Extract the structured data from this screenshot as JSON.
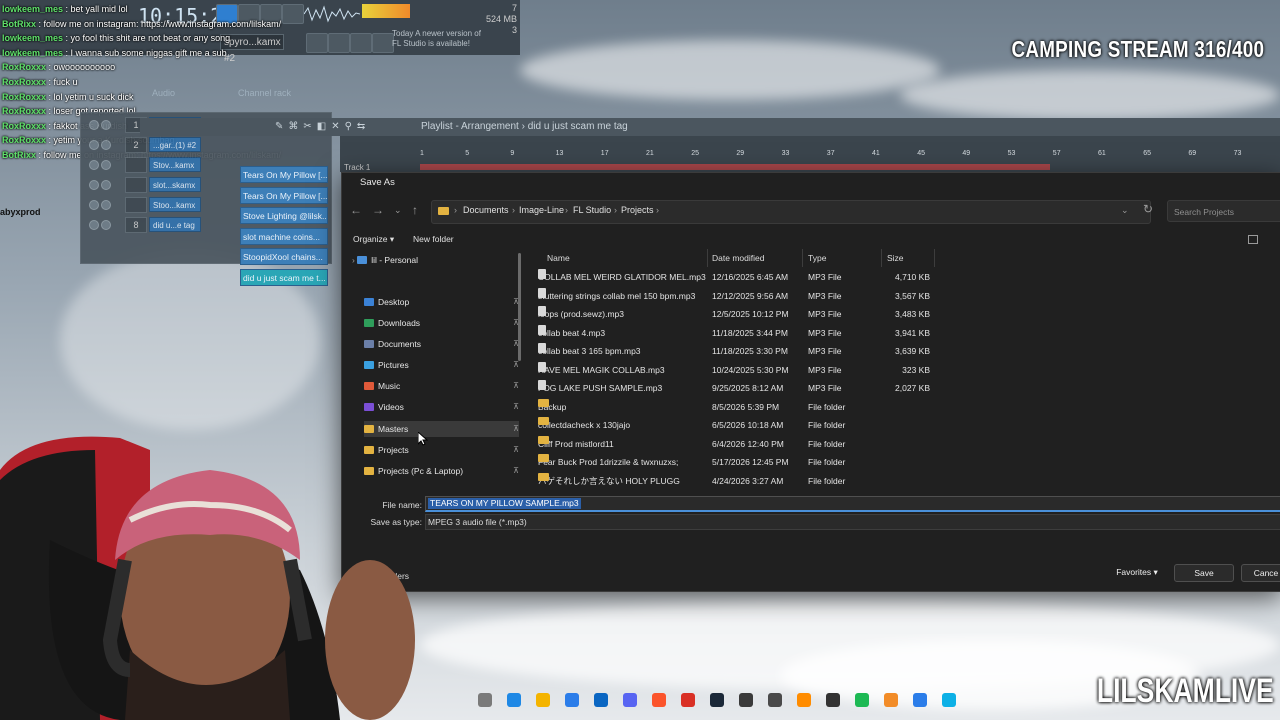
{
  "fl_studio": {
    "clock": "10:15:22",
    "stats": [
      "7",
      "524 MB",
      "3"
    ],
    "pattern_name": "spyro...kamx #2",
    "update_notice": "Today  A newer version of FL Studio is available!",
    "channel_rack_title": "Channel rack",
    "audio_label": "Audio",
    "channels": [
      {
        "num": "1",
        "label": "Tear..ls] (1)"
      },
      {
        "num": "2",
        "label": "...gar..(1) #2"
      },
      {
        "num": "",
        "label": "Stov...kamx"
      },
      {
        "num": "",
        "label": "slot...skamx"
      },
      {
        "num": "",
        "label": "Stoo...kamx"
      },
      {
        "num": "8",
        "label": "did u...e tag"
      }
    ],
    "playlist_title": "Playlist - Arrangement › did u just scam me tag",
    "track_label": "Track 1",
    "playlist_clips": [
      "Tears On My Pillow [...",
      "Tears On My Pillow [...",
      "Stove Lighting @lilsk...",
      "slot machine coins...",
      "StoopidXool chains...",
      "did u just scam me t..."
    ],
    "ruler_marks": [
      "1",
      "5",
      "9",
      "13",
      "17",
      "21",
      "25",
      "29",
      "33",
      "37",
      "41",
      "45",
      "49",
      "53",
      "57",
      "61",
      "65",
      "69",
      "73"
    ]
  },
  "chat": [
    {
      "user": "lowkeem_mes",
      "text": " : bet yall mid lol"
    },
    {
      "user": "BotRixx",
      "text": " : follow me on instagram: https://www.instagram.com/lilskam/"
    },
    {
      "user": "lowkeem_mes",
      "text": " : yo fool this shit are not beat or any song"
    },
    {
      "user": "lowkeem_mes",
      "text": " : I wanna sub some niggas gift me a sub"
    },
    {
      "user": "RoxRoxxx",
      "text": " : owoooooooooo"
    },
    {
      "user": "RoxRoxxx",
      "text": " : fuck u"
    },
    {
      "user": "RoxRoxxx",
      "text": " : lol yetim u suck dick"
    },
    {
      "user": "RoxRoxxx",
      "text": " : loser got reported lol"
    },
    {
      "user": "RoxRoxxx",
      "text": " : fakkot ass Kurdish"
    },
    {
      "user": "RoxRoxxx",
      "text": " : yetim your a Kurdish scumbag"
    },
    {
      "user": "BotRixx",
      "text": " : follow me on instagram: https://www.instagram.com/lilskam/"
    }
  ],
  "dialog": {
    "title": "Save As",
    "breadcrumbs": [
      "Documents",
      "Image-Line",
      "FL Studio",
      "Projects"
    ],
    "search_placeholder": "Search Projects",
    "organize_label": "Organize ▾",
    "new_folder_label": "New folder",
    "nav_items": [
      {
        "label": "lil - Personal",
        "color": "#4a90d9"
      },
      {
        "label": "Desktop",
        "color": "#3b82d6"
      },
      {
        "label": "Downloads",
        "color": "#2f9e5b"
      },
      {
        "label": "Documents",
        "color": "#6b7fa8"
      },
      {
        "label": "Pictures",
        "color": "#3aa0e0"
      },
      {
        "label": "Music",
        "color": "#e05a3a"
      },
      {
        "label": "Videos",
        "color": "#7b4fd6"
      },
      {
        "label": "Masters",
        "color": "#e3b341"
      },
      {
        "label": "Projects",
        "color": "#e3b341"
      },
      {
        "label": "Projects (Pc & Laptop)",
        "color": "#e3b341"
      }
    ],
    "columns": {
      "name": "Name",
      "date": "Date modified",
      "type": "Type",
      "size": "Size"
    },
    "files": [
      {
        "name": "COLLAB MEL WEIRD GLATIDOR MEL.mp3",
        "date": "12/16/2025 6:45 AM",
        "type": "MP3 File",
        "size": "4,710 KB",
        "kind": "mp3"
      },
      {
        "name": "stuttering strings collab mel 150 bpm.mp3",
        "date": "12/12/2025 9:56 AM",
        "type": "MP3 File",
        "size": "3,567 KB",
        "kind": "mp3"
      },
      {
        "name": "loops (prod.sewz).mp3",
        "date": "12/5/2025 10:12 PM",
        "type": "MP3 File",
        "size": "3,483 KB",
        "kind": "mp3"
      },
      {
        "name": "collab beat 4.mp3",
        "date": "11/18/2025 3:44 PM",
        "type": "MP3 File",
        "size": "3,941 KB",
        "kind": "mp3"
      },
      {
        "name": "collab beat 3 165 bpm.mp3",
        "date": "11/18/2025 3:30 PM",
        "type": "MP3 File",
        "size": "3,639 KB",
        "kind": "mp3"
      },
      {
        "name": "RAVE MEL MAGIK COLLAB.mp3",
        "date": "10/24/2025 5:30 PM",
        "type": "MP3 File",
        "size": "323 KB",
        "kind": "mp3"
      },
      {
        "name": "FOG LAKE PUSH SAMPLE.mp3",
        "date": "9/25/2025 8:12 AM",
        "type": "MP3 File",
        "size": "2,027 KB",
        "kind": "mp3"
      },
      {
        "name": "Backup",
        "date": "8/5/2026 5:39 PM",
        "type": "File folder",
        "size": "",
        "kind": "folder"
      },
      {
        "name": "collectdacheck x 130jajo",
        "date": "6/5/2026 10:18 AM",
        "type": "File folder",
        "size": "",
        "kind": "folder"
      },
      {
        "name": "Cliff Prod mistlord11",
        "date": "6/4/2026 12:40 PM",
        "type": "File folder",
        "size": "",
        "kind": "folder"
      },
      {
        "name": "Fear Buck Prod 1drizzile & twxnuzxs;",
        "date": "5/17/2026 12:45 PM",
        "type": "File folder",
        "size": "",
        "kind": "folder"
      },
      {
        "name": "ハゲそれしか言えない HOLY PLUGG",
        "date": "4/24/2026 3:27 AM",
        "type": "File folder",
        "size": "",
        "kind": "folder"
      }
    ],
    "file_name_label": "File name:",
    "file_name_value": "TEARS ON MY PILLOW SAMPLE.mp3",
    "save_type_label": "Save as type:",
    "save_type_value": "MPEG 3 audio file (*.mp3)",
    "hide_folders_label": "ide Folders",
    "favorites_label": "Favorites",
    "save_label": "Save",
    "cancel_label": "Cance"
  },
  "overlay": {
    "stream_title": "CAMPING STREAM 316/400",
    "channel_name": "LILSKAMLIVE",
    "side_label": "abyxprod"
  }
}
